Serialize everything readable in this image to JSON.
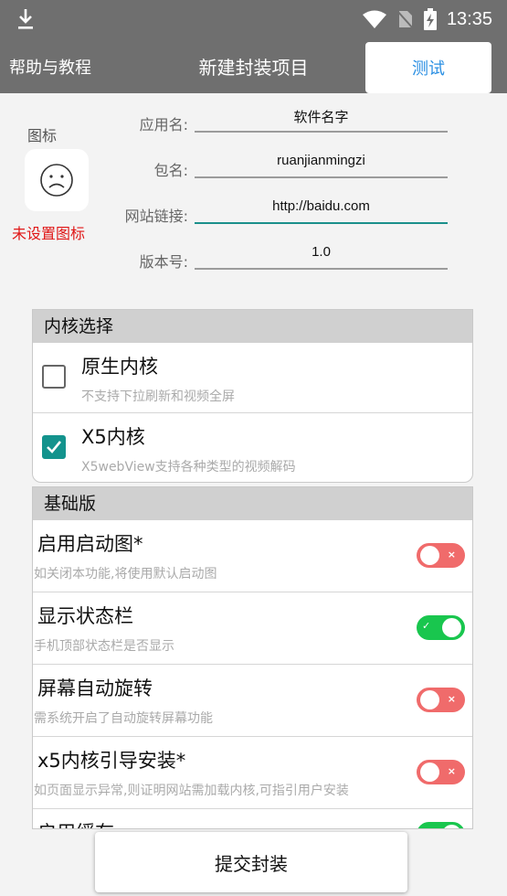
{
  "status_bar": {
    "time": "13:35"
  },
  "toolbar": {
    "help_label": "帮助与教程",
    "title": "新建封装项目",
    "test_label": "测试"
  },
  "icon_section": {
    "label": "图标",
    "not_set_text": "未设置图标"
  },
  "fields": [
    {
      "label": "应用名:",
      "value": "软件名字"
    },
    {
      "label": "包名:",
      "value": "ruanjianmingzi"
    },
    {
      "label": "网站链接:",
      "value": "http://baidu.com"
    },
    {
      "label": "版本号:",
      "value": "1.0"
    }
  ],
  "kernel": {
    "header": "内核选择",
    "options": [
      {
        "title": "原生内核",
        "desc": "不支持下拉刷新和视频全屏",
        "checked": false
      },
      {
        "title": "X5内核",
        "desc": "X5webView支持各种类型的视频解码",
        "checked": true
      }
    ]
  },
  "basic": {
    "header": "基础版",
    "settings": [
      {
        "title": "启用启动图*",
        "desc": "如关闭本功能,将使用默认启动图",
        "enabled": false
      },
      {
        "title": "显示状态栏",
        "desc": "手机顶部状态栏是否显示",
        "enabled": true
      },
      {
        "title": "屏幕自动旋转",
        "desc": "需系统开启了自动旋转屏幕功能",
        "enabled": false
      },
      {
        "title": "x5内核引导安装*",
        "desc": "如页面显示异常,则证明网站需加载内核,可指引用户安装",
        "enabled": false
      },
      {
        "title": "启用缓存",
        "desc": "",
        "enabled": true
      }
    ]
  },
  "submit_label": "提交封装",
  "colors": {
    "accent": "#13938d",
    "toggle_on": "#19c64e",
    "toggle_off": "#f06b6b",
    "link": "#2a8fe3",
    "error": "#e01616"
  }
}
